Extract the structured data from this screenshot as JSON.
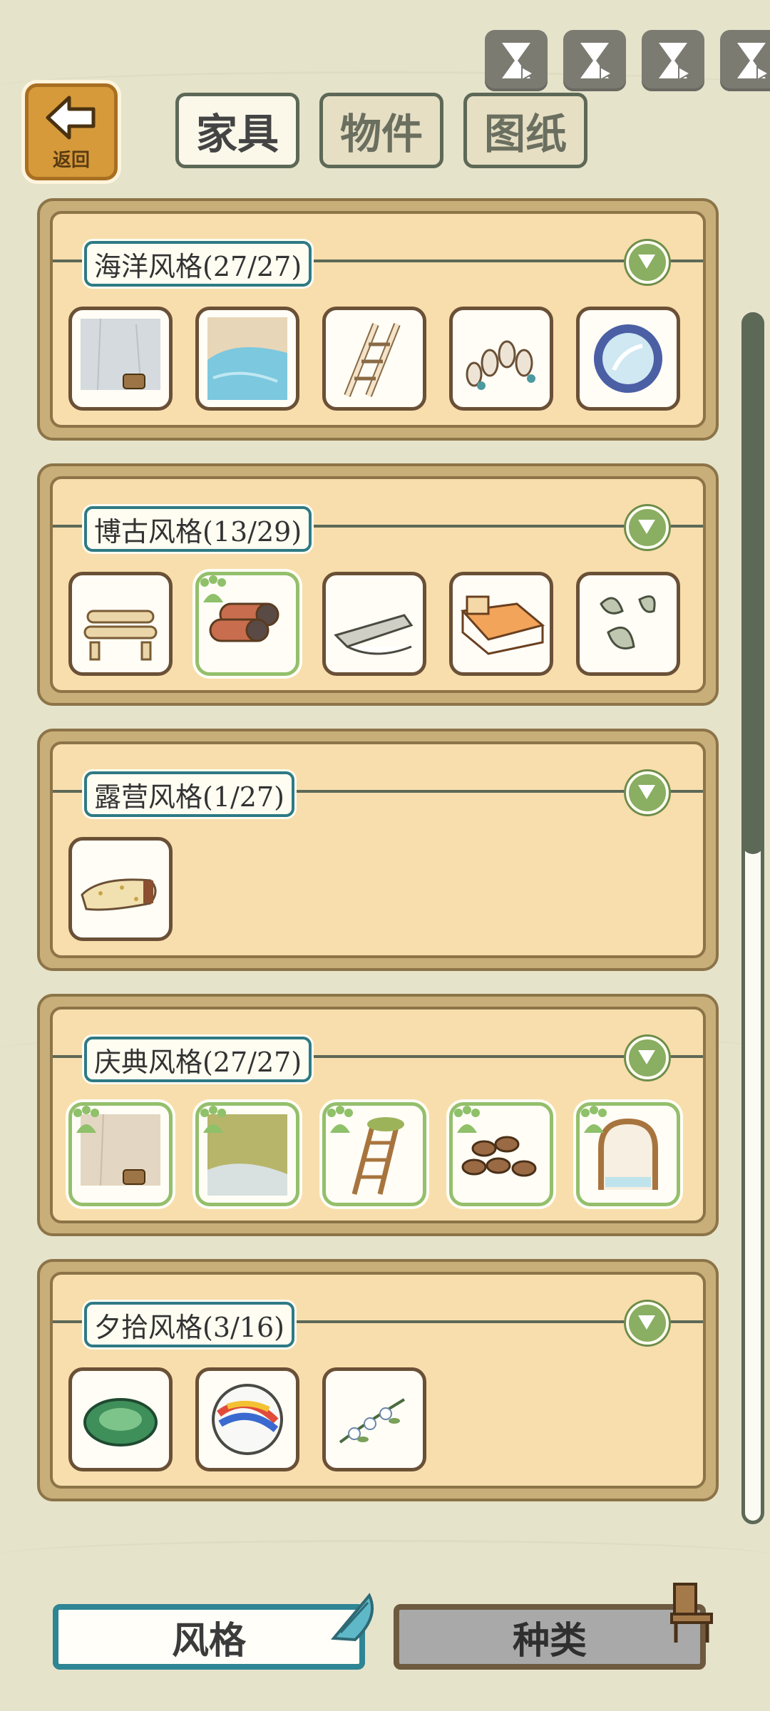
{
  "header": {
    "back_label": "返回",
    "tabs": [
      {
        "label": "家具",
        "active": true
      },
      {
        "label": "物件",
        "active": false
      },
      {
        "label": "图纸",
        "active": false
      }
    ],
    "top_icons": [
      "hourglass-play-icon",
      "hourglass-play-icon",
      "hourglass-play-icon",
      "hourglass-play-icon"
    ]
  },
  "sections": [
    {
      "title": "海洋风格(27/27)",
      "items": [
        "stone-wall-bucket",
        "pool-floor",
        "wooden-ladder",
        "stone-steps",
        "porthole-window"
      ],
      "new": [
        false,
        false,
        false,
        false,
        false
      ]
    },
    {
      "title": "博古风格(13/29)",
      "items": [
        "log-bench",
        "rolled-mats",
        "scroll",
        "wooden-bed",
        "cloud-ornament"
      ],
      "new": [
        false,
        true,
        false,
        false,
        false
      ]
    },
    {
      "title": "露营风格(1/27)",
      "items": [
        "sleeping-bag"
      ],
      "new": [
        false
      ]
    },
    {
      "title": "庆典风格(27/27)",
      "items": [
        "wall-bucket",
        "grass-floor",
        "flower-ladder",
        "clay-pots",
        "arched-window"
      ],
      "new": [
        true,
        true,
        true,
        true,
        true
      ]
    },
    {
      "title": "夕拾风格(3/16)",
      "items": [
        "green-stone",
        "marble-ball",
        "flower-branch"
      ],
      "new": [
        false,
        false,
        false
      ]
    }
  ],
  "bottom": {
    "style_label": "风格",
    "kind_label": "种类"
  },
  "colors": {
    "background": "#e6e3cb",
    "panel": "#f8deac",
    "accent_teal": "#2e8593",
    "accent_green": "#8aae62"
  }
}
